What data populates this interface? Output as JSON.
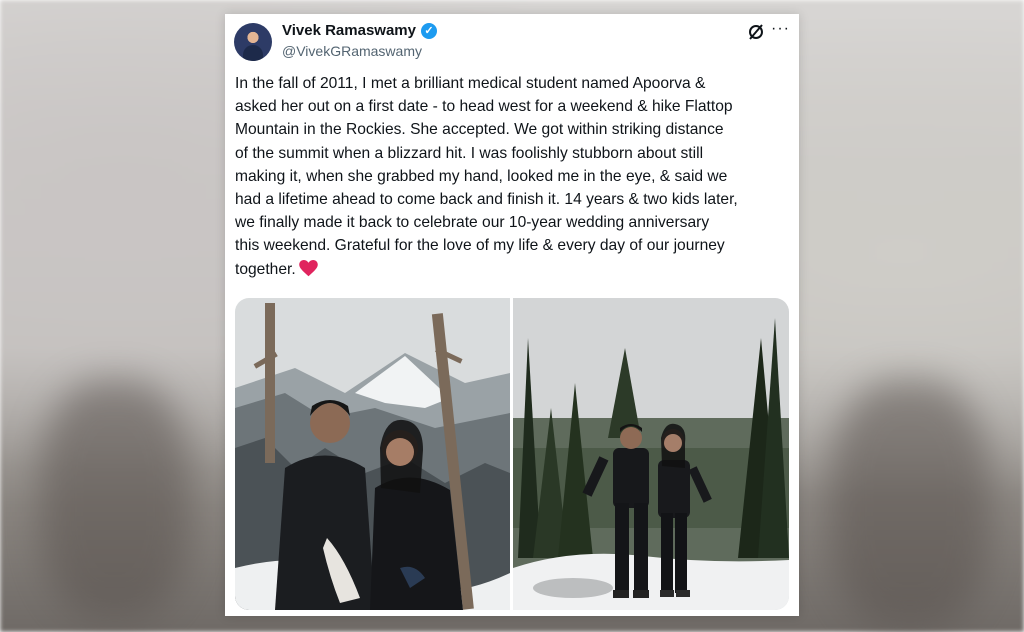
{
  "colors": {
    "verified": "#1d9bf0",
    "heart": "#f91880",
    "text": "#0f1419",
    "muted": "#536471"
  },
  "tweet": {
    "author": {
      "display_name": "Vivek Ramaswamy",
      "handle": "@VivekGRamaswamy",
      "verified_icon": "verified-badge-icon"
    },
    "header_icons": [
      "grok-icon",
      "more-icon"
    ],
    "more_label": "···",
    "text": "In the fall of 2011, I met a brilliant medical student named Apoorva &\nasked her out on a first date - to head west for a weekend & hike Flattop\nMountain in the Rockies. She accepted. We got within striking distance\nof the summit when a blizzard hit. I was foolishly stubborn about still\nmaking it, when she grabbed my hand, looked me in the eye, & said we\nhad a lifetime ahead to come back and finish it. 14 years & two kids later,\nwe finally made it back to celebrate our 10-year wedding anniversary\nthis weekend. Grateful for the love of my life & every day of our journey\ntogether.",
    "emoji": "red-heart-icon",
    "media": [
      {
        "name": "couple-snowy-mountain-photo"
      },
      {
        "name": "couple-forest-overlook-photo"
      }
    ]
  }
}
